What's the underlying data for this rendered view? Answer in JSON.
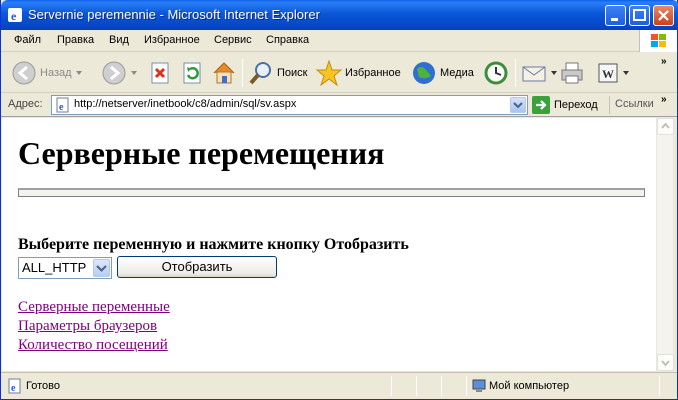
{
  "window": {
    "title": "Servernie peremennie - Microsoft Internet Explorer"
  },
  "menu": [
    "Файл",
    "Правка",
    "Вид",
    "Избранное",
    "Сервис",
    "Справка"
  ],
  "toolbar": {
    "back": "Назад",
    "search": "Поиск",
    "favorites": "Избранное",
    "media": "Медиа"
  },
  "address": {
    "label": "Адрес:",
    "url": "http://netserver/inetbook/c8/admin/sql/sv.aspx",
    "go": "Переход",
    "links": "Ссылки"
  },
  "page": {
    "heading": "Серверные перемещения",
    "prompt": "Выберите переменную и нажмите кнопку Отобразить",
    "select_value": "ALL_HTTP",
    "button": "Отобразить",
    "links": [
      "Серверные переменные",
      "Параметры браузеров",
      "Количество посещений"
    ]
  },
  "status": {
    "text": "Готово",
    "zone": "Мой компьютер"
  },
  "colors": {
    "titlebar": "#0a57d8",
    "visited_link": "#800080",
    "chrome": "#ece9d8"
  }
}
